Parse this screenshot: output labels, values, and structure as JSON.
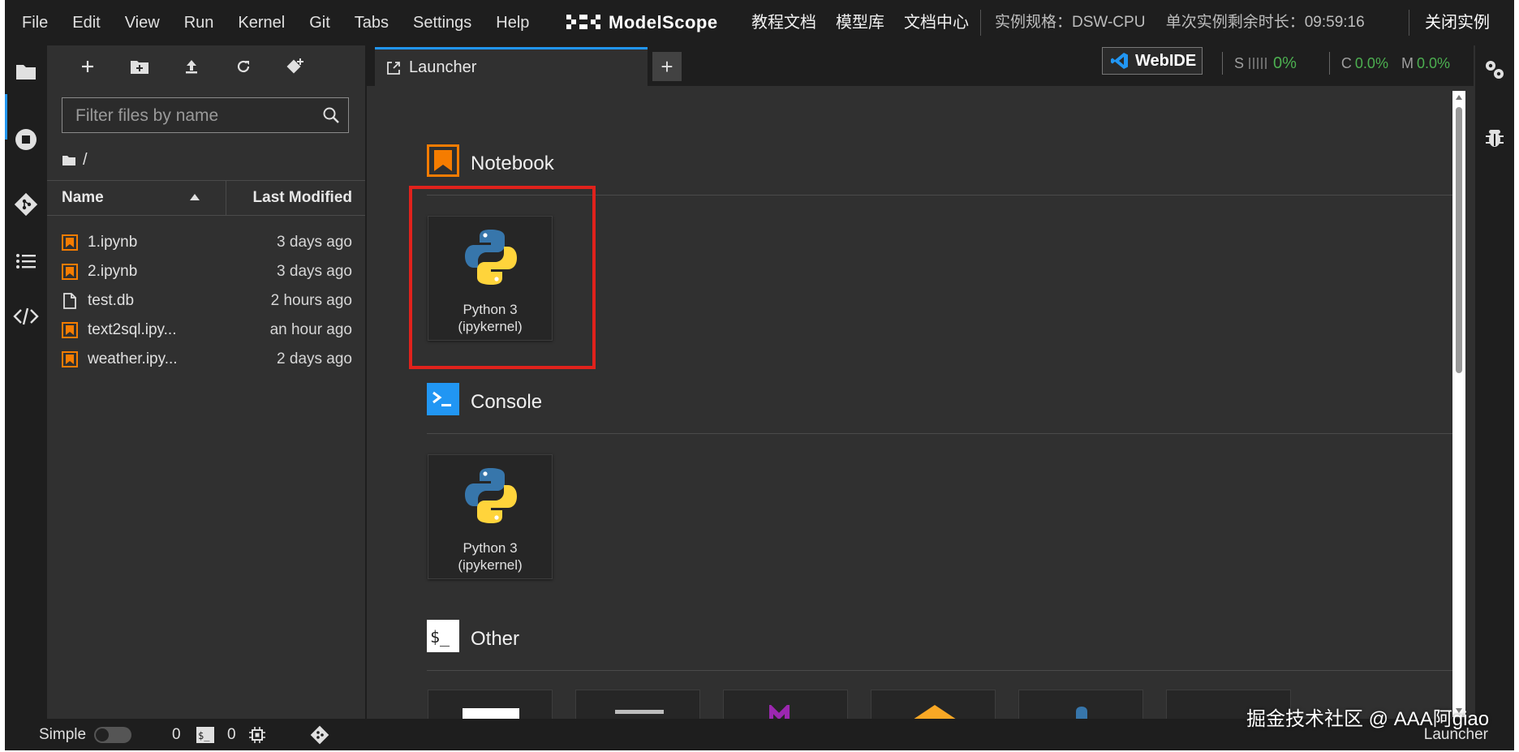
{
  "menubar": {
    "items": [
      "File",
      "Edit",
      "View",
      "Run",
      "Kernel",
      "Git",
      "Tabs",
      "Settings",
      "Help"
    ],
    "brand": "ModelScope",
    "links": [
      "教程文档",
      "模型库",
      "文档中心"
    ],
    "instance_spec": "实例规格：DSW-CPU",
    "remaining_time": "单次实例剩余时长：09:59:16",
    "close_label": "关闭实例"
  },
  "filebrowser": {
    "filter_placeholder": "Filter files by name",
    "path": "/",
    "columns": {
      "name": "Name",
      "modified": "Last Modified"
    },
    "files": [
      {
        "name": "1.ipynb",
        "modified": "3 days ago",
        "icon": "notebook-icon"
      },
      {
        "name": "2.ipynb",
        "modified": "3 days ago",
        "icon": "notebook-icon"
      },
      {
        "name": "test.db",
        "modified": "2 hours ago",
        "icon": "file-icon"
      },
      {
        "name": "text2sql.ipy...",
        "modified": "an hour ago",
        "icon": "notebook-icon"
      },
      {
        "name": "weather.ipy...",
        "modified": "2 days ago",
        "icon": "notebook-icon"
      }
    ]
  },
  "tabs": {
    "active_label": "Launcher",
    "add_label": "+"
  },
  "toolbar_right": {
    "webide_label": "WebIDE",
    "s_label": "S",
    "s_value": "0%",
    "c_label": "C",
    "c_value": "0.0%",
    "m_label": "M",
    "m_value": "0.0%"
  },
  "launcher": {
    "notebook": {
      "title": "Notebook",
      "card_label_1": "Python 3",
      "card_label_2": "(ipykernel)"
    },
    "console": {
      "title": "Console",
      "card_label_1": "Python 3",
      "card_label_2": "(ipykernel)"
    },
    "other": {
      "title": "Other"
    }
  },
  "statusbar": {
    "mode_label": "Simple",
    "kernels_count": "0",
    "terminals_count": "0",
    "right_label": "Launcher"
  },
  "watermark": "掘金技术社区 @ AAA阿giao",
  "colors": {
    "accent": "#2196f3",
    "notebook_orange": "#f57c00",
    "highlight_red": "#e0221c",
    "status_green": "#4caf50"
  }
}
